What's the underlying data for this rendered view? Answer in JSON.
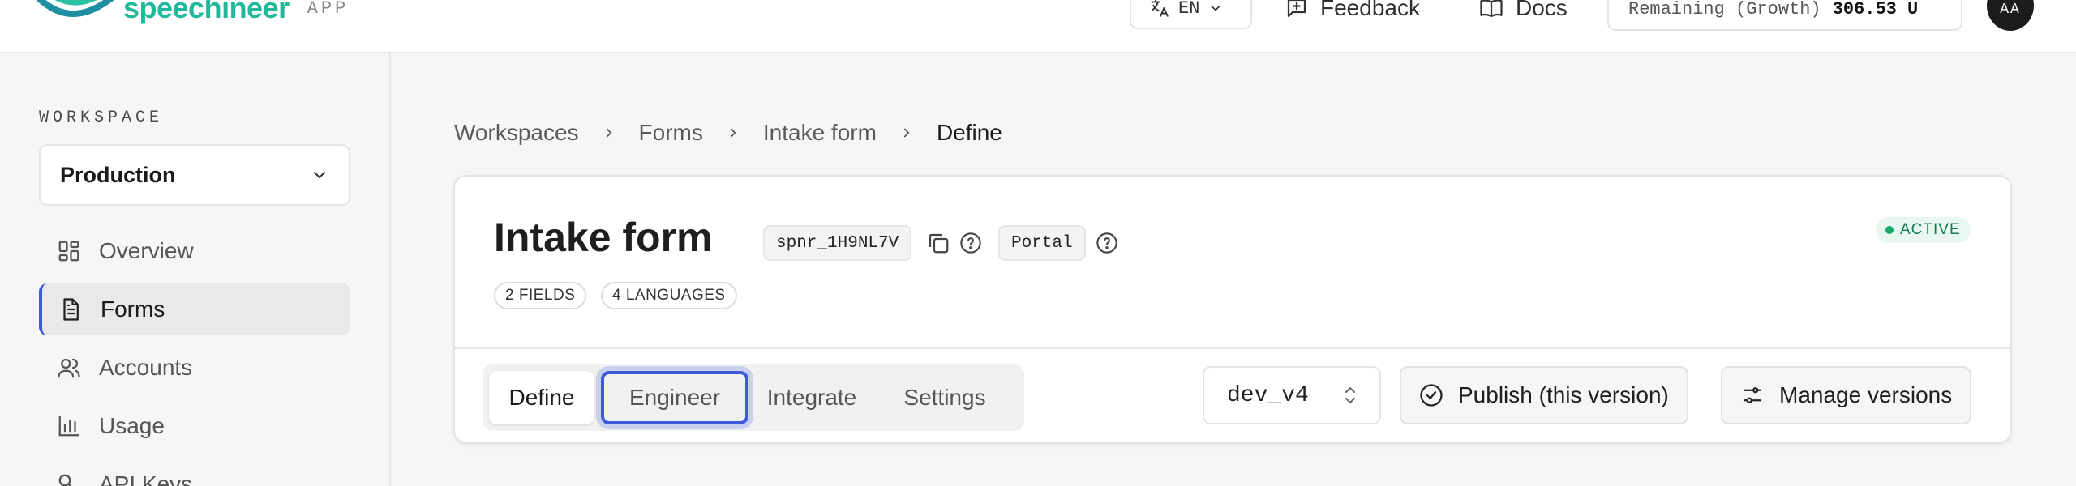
{
  "header": {
    "logo_text": "speechineer",
    "logo_sub": "APP",
    "language": "EN",
    "feedback_label": "Feedback",
    "docs_label": "Docs",
    "remaining_label": "Remaining (Growth)",
    "remaining_value": "306.53 U",
    "avatar_initials": "AA"
  },
  "sidebar": {
    "workspace_label": "WORKSPACE",
    "workspace_value": "Production",
    "items": [
      {
        "label": "Overview",
        "icon": "layout-grid-icon"
      },
      {
        "label": "Forms",
        "icon": "document-icon",
        "active": true
      },
      {
        "label": "Accounts",
        "icon": "users-icon"
      },
      {
        "label": "Usage",
        "icon": "bar-chart-icon"
      },
      {
        "label": "API Keys",
        "icon": "key-icon"
      }
    ]
  },
  "breadcrumb": [
    "Workspaces",
    "Forms",
    "Intake form",
    "Define"
  ],
  "card": {
    "title": "Intake form",
    "id": "spnr_1H9NL7V",
    "portal": "Portal",
    "status": "ACTIVE",
    "pills": [
      "2 FIELDS",
      "4 LANGUAGES"
    ],
    "tabs": [
      "Define",
      "Engineer",
      "Integrate",
      "Settings"
    ],
    "selected_tab": "Define",
    "focused_tab": "Engineer",
    "version": "dev_v4",
    "publish_label": "Publish (this version)",
    "manage_label": "Manage versions"
  },
  "colors": {
    "accent": "#3b5bdb",
    "brand": "#22b89a",
    "status_active": "#18a86b"
  }
}
